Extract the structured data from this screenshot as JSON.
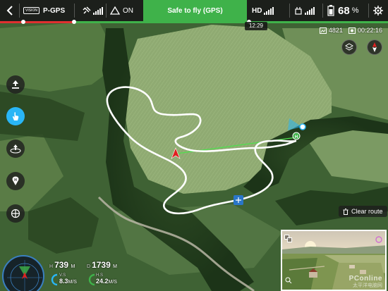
{
  "topbar": {
    "flight_mode_badge": "VISION",
    "flight_mode": "P-GPS",
    "obstacle_label": "ON",
    "status_message": "Safe to fly (GPS)",
    "hd_label": "HD",
    "battery_percent": "68",
    "battery_unit": "%"
  },
  "clock": "12:29",
  "info": {
    "remaining_shots": "4821",
    "flight_time": "00:22:16"
  },
  "map": {
    "clear_route_label": "Clear route"
  },
  "telemetry": {
    "height_label": "H",
    "height_value": "739",
    "height_unit": "M",
    "distance_label": "D",
    "distance_value": "1739",
    "distance_unit": "M",
    "vs_label": "V.S",
    "vs_value": "8.3",
    "vs_unit": "M/S",
    "hs_label": "H.S",
    "hs_value": "24.2",
    "hs_unit": "M/S"
  },
  "fpv": {
    "watermark": "PConline",
    "watermark_sub": "太平洋电脑网"
  },
  "colors": {
    "safe_green": "#3fb24a",
    "route_white": "#ffffff",
    "aircraft_red": "#e02020",
    "accent_blue": "#29b6f6",
    "topbar_bg": "#191919"
  },
  "icons": [
    "back-icon",
    "satellite-icon",
    "obstacle-icon",
    "signal-icon",
    "battery-icon",
    "settings-icon",
    "layers-icon",
    "compass-icon",
    "takeoff-icon",
    "touch-icon",
    "waypoint-icon",
    "poi-icon",
    "camera-icon",
    "trash-icon",
    "swap-icon",
    "fullscreen-icon"
  ]
}
